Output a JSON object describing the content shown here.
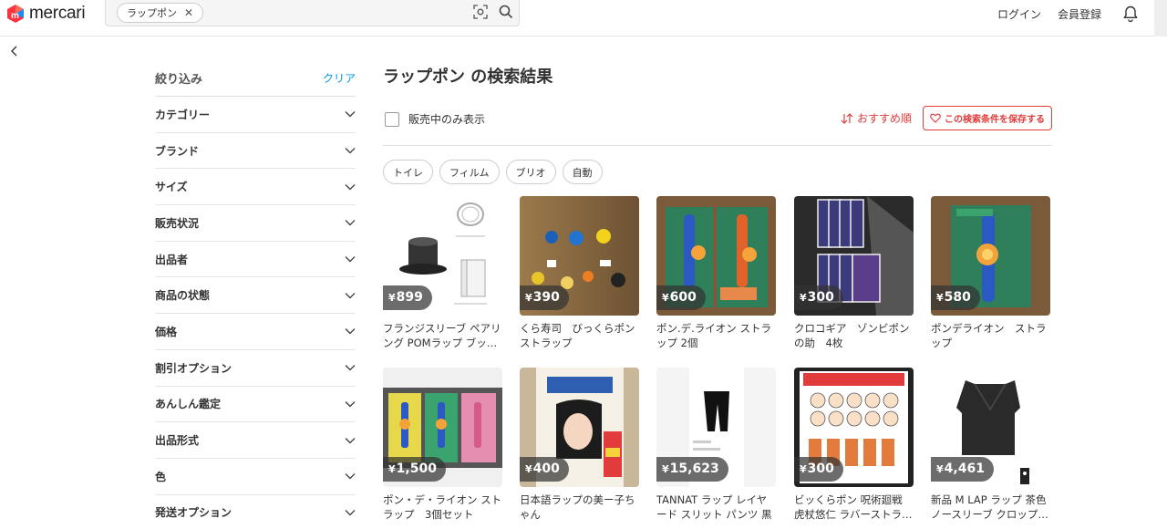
{
  "header": {
    "logo_text": "mercari",
    "search_query": "ラップポン",
    "login": "ログイン",
    "register": "会員登録"
  },
  "sidebar": {
    "title": "絞り込み",
    "clear": "クリア",
    "items": [
      "カテゴリー",
      "ブランド",
      "サイズ",
      "販売状況",
      "出品者",
      "商品の状態",
      "価格",
      "割引オプション",
      "あんしん鑑定",
      "出品形式",
      "色",
      "発送オプション"
    ]
  },
  "main": {
    "title": "ラップポン の検索結果",
    "on_sale_only": "販売中のみ表示",
    "sort": "おすすめ順",
    "save_search": "この検索条件を保存する",
    "chips": [
      "トイレ",
      "フィルム",
      "ブリオ",
      "自動"
    ]
  },
  "items": [
    {
      "price": "899",
      "name": "フランジスリーブ ペアリング POMラップ ブッ…"
    },
    {
      "price": "390",
      "name": "くら寿司　びっくらポン ストラップ"
    },
    {
      "price": "600",
      "name": "ポン.デ.ライオン ストラップ 2個"
    },
    {
      "price": "300",
      "name": "クロコギア　ゾンビポンの助　4枚"
    },
    {
      "price": "580",
      "name": "ポンデライオン　ストラップ"
    },
    {
      "price": "1,500",
      "name": "ポン・デ・ライオン ストラップ　3個セット"
    },
    {
      "price": "400",
      "name": "日本語ラップの美ー子ちゃん"
    },
    {
      "price": "15,623",
      "name": "TANNAT ラップ レイヤード スリット パンツ 黒"
    },
    {
      "price": "300",
      "name": "ビッくらポン 呪術廻戦 虎杖悠仁 ラバーストラ…"
    },
    {
      "price": "4,461",
      "name": "新品 M LAP ラップ 茶色 ノースリーブ クロップ…"
    }
  ],
  "colors": {
    "accent_red": "#e03c3c",
    "link_blue": "#0095ee",
    "price_badge": "#333333"
  },
  "icons": [
    "mercari-logo-icon",
    "close-icon",
    "image-search-icon",
    "search-icon",
    "bell-icon",
    "back-arrow-icon",
    "chevron-down-icon",
    "sort-icon",
    "heart-icon"
  ]
}
